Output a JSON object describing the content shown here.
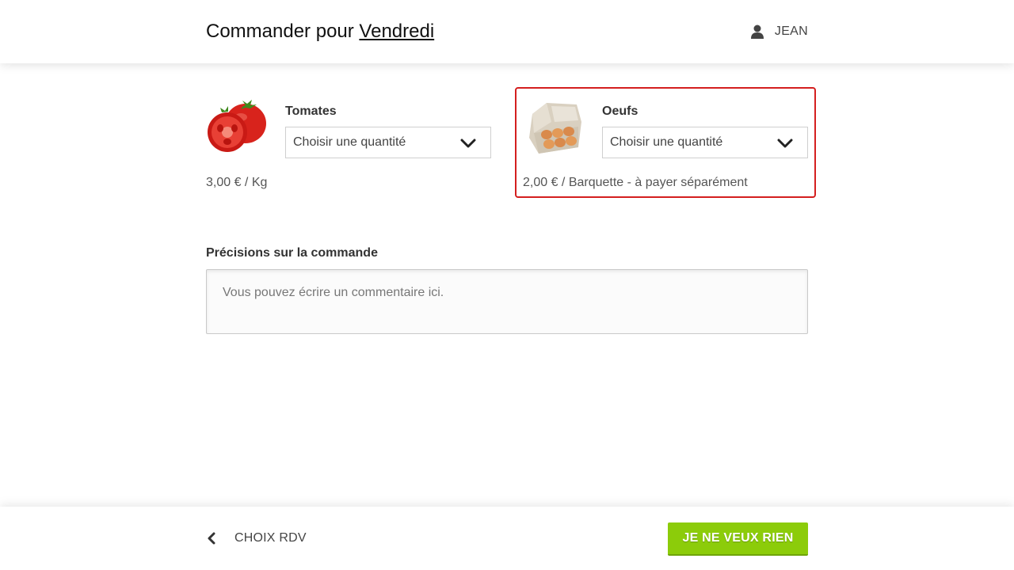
{
  "header": {
    "title_prefix": "Commander pour",
    "day_link": "Vendredi",
    "user_icon": "user-icon",
    "user_name": "JEAN"
  },
  "products": [
    {
      "name": "Tomates",
      "image": "tomato-image",
      "select_label": "Choisir une quantité",
      "price": "3,00 € / Kg",
      "selected": false
    },
    {
      "name": "Oeufs",
      "image": "eggs-image",
      "select_label": "Choisir une quantité",
      "price": "2,00 € / Barquette - à payer séparément",
      "selected": true
    }
  ],
  "notes": {
    "label": "Précisions sur la commande",
    "placeholder": "Vous pouvez écrire un commentaire ici.",
    "value": ""
  },
  "footer": {
    "back_icon": "chevron-left-icon",
    "back_label": "CHOIX RDV",
    "none_button": "JE NE VEUX RIEN"
  },
  "colors": {
    "accent_green": "#8ccc0a",
    "selected_border": "#d41f1f"
  }
}
